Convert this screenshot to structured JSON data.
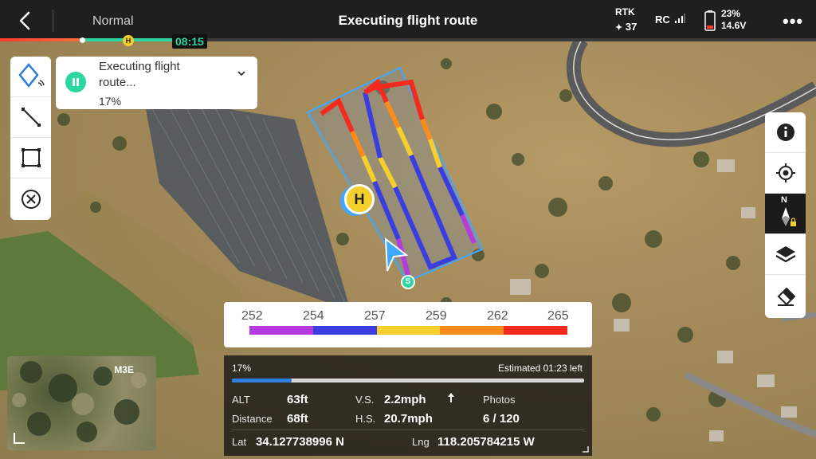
{
  "topbar": {
    "mode": "Normal",
    "title": "Executing flight route",
    "rtk_label": "RTK",
    "rtk_satellites": "37",
    "rc_label": "RC",
    "battery_percent": "23%",
    "battery_voltage": "14.6V",
    "flight_time": "08:15",
    "home_marker": "H"
  },
  "status_card": {
    "text": "Executing flight route...",
    "percent": "17%"
  },
  "map": {
    "home_marker": "H",
    "start_marker": "S"
  },
  "right_tools": {
    "compass_north": "N"
  },
  "legend": {
    "ticks": [
      "252",
      "254",
      "257",
      "259",
      "262",
      "265"
    ],
    "colors": [
      "#b53ae0",
      "#3a3ee0",
      "#f7cf2c",
      "#fb8c1a",
      "#f52a1e"
    ]
  },
  "telemetry": {
    "progress_percent": "17%",
    "progress_value": 0.17,
    "estimated": "Estimated 01:23 left",
    "alt_label": "ALT",
    "alt_value": "63ft",
    "vs_label": "V.S.",
    "vs_value": "2.2mph",
    "photos_label": "Photos",
    "photos_value": "6 / 120",
    "distance_label": "Distance",
    "distance_value": "68ft",
    "hs_label": "H.S.",
    "hs_value": "20.7mph",
    "lat_label": "Lat",
    "lat_value": "34.127738996 N",
    "lng_label": "Lng",
    "lng_value": "118.205784215 W"
  },
  "camera": {
    "label": "M3E"
  },
  "colors": {
    "accent_green": "#2bd6a0",
    "route_blue": "#3a3ee0",
    "marker_yellow": "#f7cf2c"
  }
}
